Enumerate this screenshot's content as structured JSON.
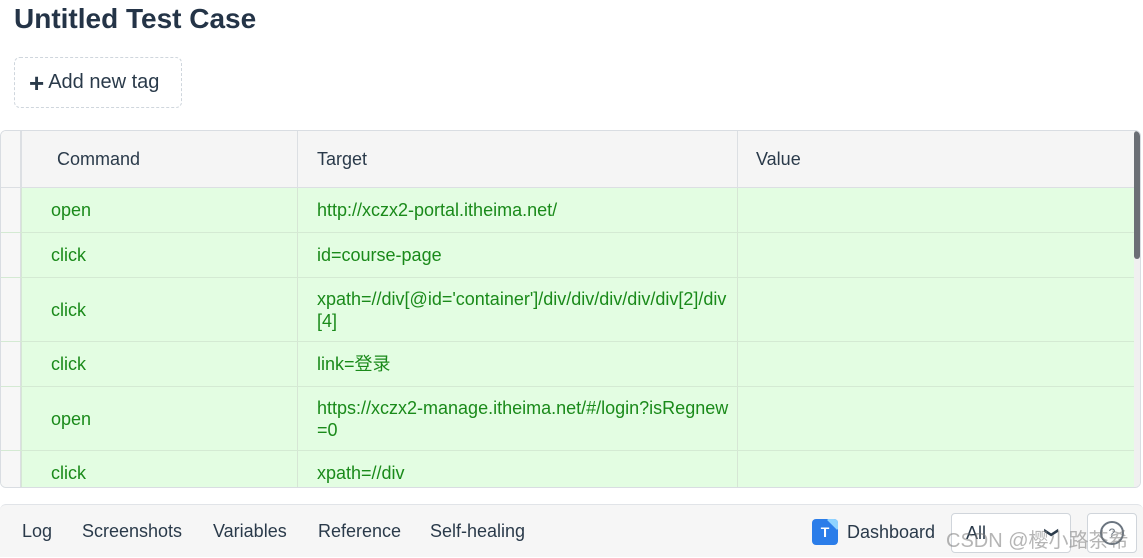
{
  "test_case": {
    "title": "Untitled Test Case"
  },
  "tag": {
    "label": "Add new tag",
    "icon": "plus-icon"
  },
  "table": {
    "columns": [
      "Command",
      "Target",
      "Value"
    ],
    "rows": [
      {
        "command": "open",
        "target": "http://xczx2-portal.itheima.net/",
        "value": ""
      },
      {
        "command": "click",
        "target": "id=course-page",
        "value": ""
      },
      {
        "command": "click",
        "target": "xpath=//div[@id='container']/div/div/div/div/div[2]/div[4]",
        "value": ""
      },
      {
        "command": "click",
        "target": "link=登录",
        "value": ""
      },
      {
        "command": "open",
        "target": "https://xczx2-manage.itheima.net/#/login?isRegnew=0",
        "value": ""
      },
      {
        "command": "click",
        "target": "xpath=//div",
        "value": ""
      }
    ]
  },
  "bottom_tabs": [
    "Log",
    "Screenshots",
    "Variables",
    "Reference",
    "Self-healing"
  ],
  "dashboard": {
    "label": "Dashboard",
    "icon": "dashboard-logo-icon"
  },
  "filter": {
    "selected": "All"
  },
  "watermark": "CSDN @樱小路茶希",
  "colors": {
    "row_bg": "#e3fde2",
    "row_text": "#1a8a1a",
    "logo": "#2b7de9"
  }
}
